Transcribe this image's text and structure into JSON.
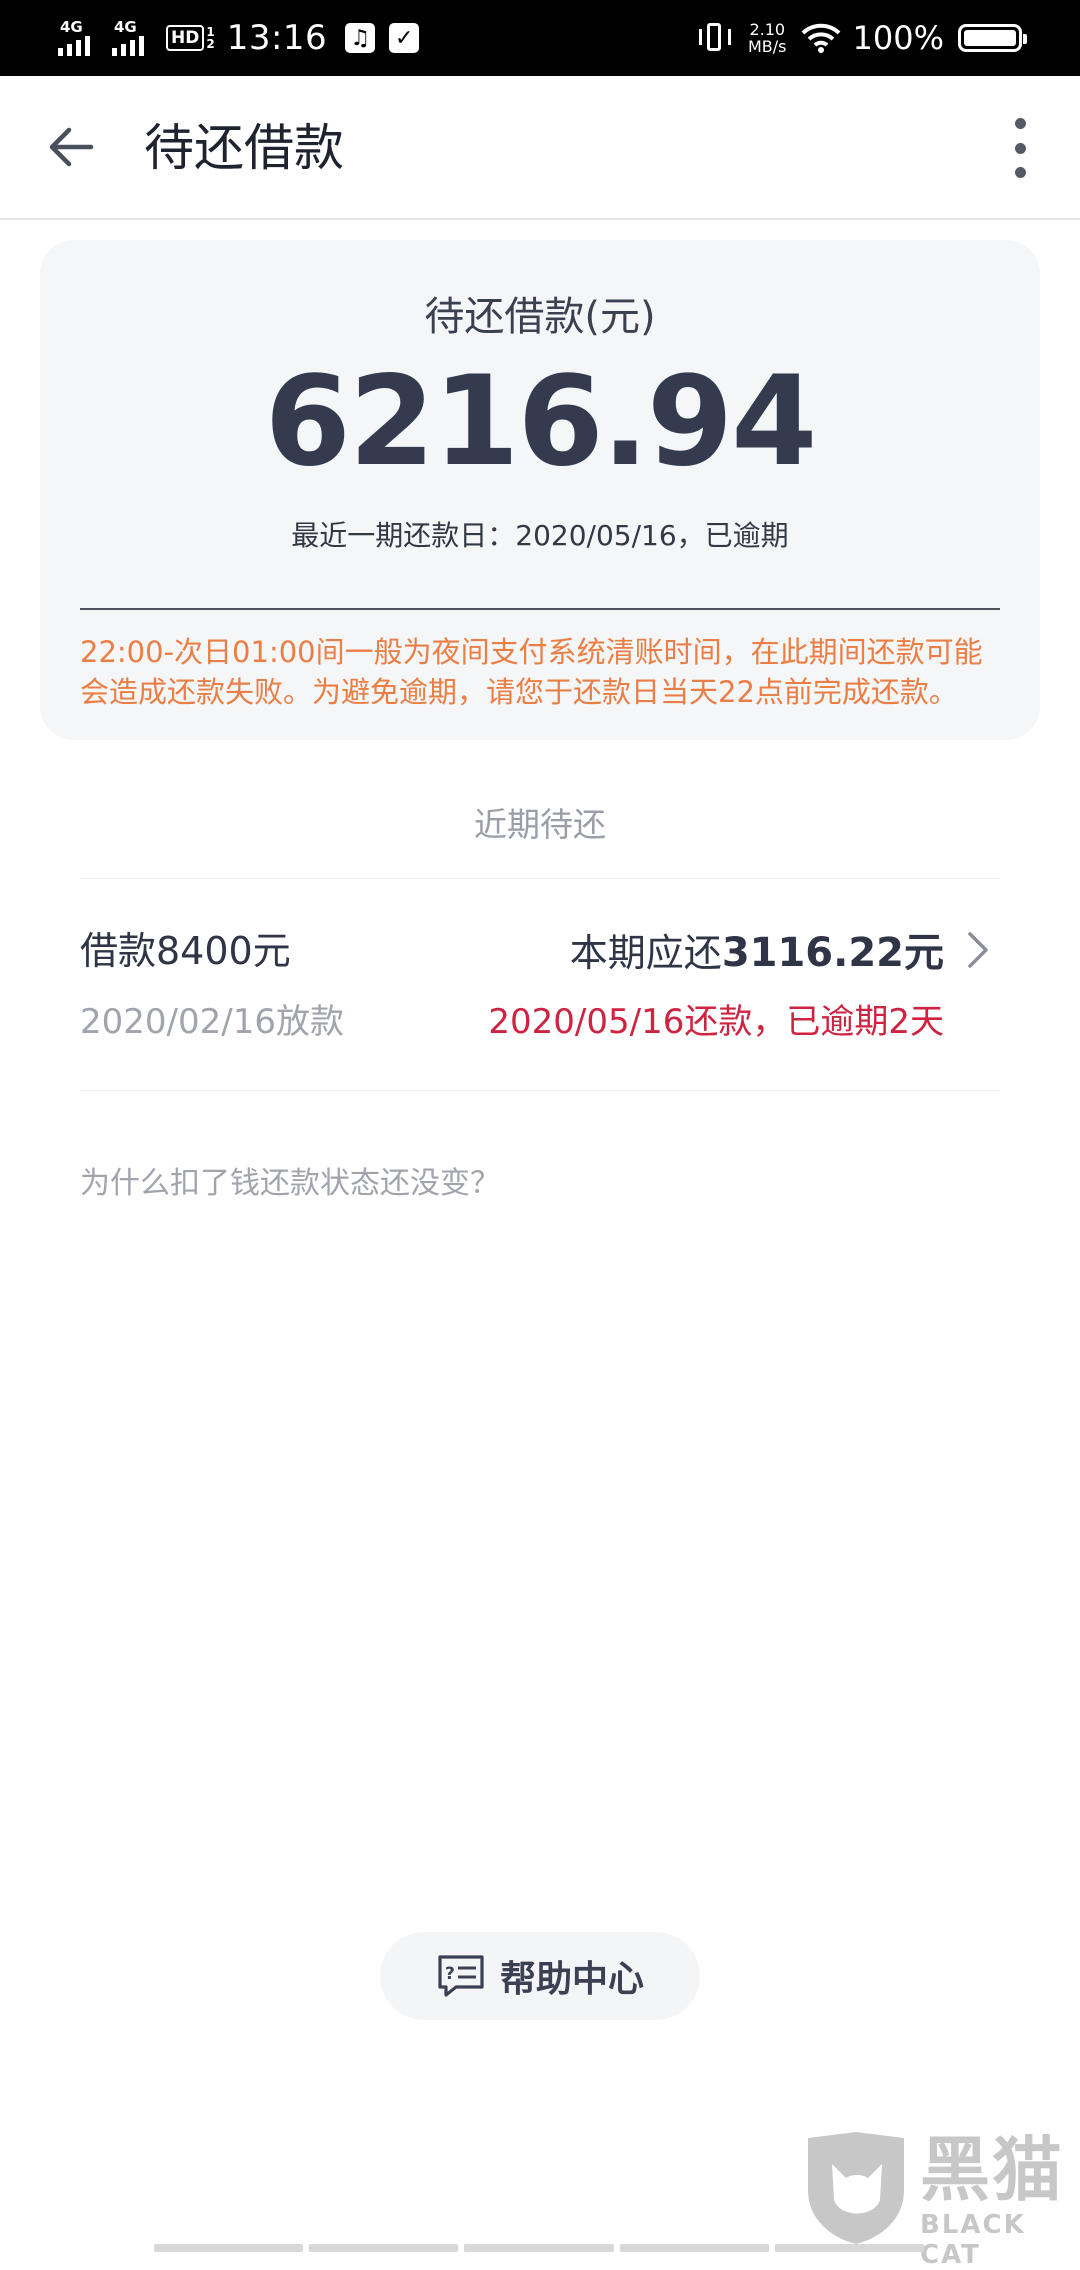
{
  "status_bar": {
    "net1": "4G",
    "net2": "4G",
    "hd_label": "HD",
    "hd_sub_top": "1",
    "hd_sub_bottom": "2",
    "time": "13:16",
    "speed_value": "2.10",
    "speed_unit": "MB/s",
    "battery_percent": "100%",
    "battery_level": 1.0
  },
  "header": {
    "title": "待还借款"
  },
  "summary": {
    "label": "待还借款(元)",
    "amount": "6216.94",
    "due_text": "最近一期还款日：2020/05/16，已逾期",
    "notice": "22:00-次日01:00间一般为夜间支付系统清账时间，在此期间还款可能会造成还款失败。为避免逾期，请您于还款日当天22点前完成还款。"
  },
  "recent": {
    "section_title": "近期待还",
    "loan": {
      "title": "借款8400元",
      "date": "2020/02/16放款",
      "due_prefix": "本期应还",
      "due_amount": "3116.22元",
      "overdue": "2020/05/16还款，已逾期2天"
    },
    "faq": "为什么扣了钱还款状态还没变？"
  },
  "help": {
    "label": "帮助中心"
  },
  "watermark": {
    "brand": "黑猫",
    "sub": "BLACK CAT"
  },
  "colors": {
    "accent_orange": "#ea7e45",
    "overdue_red": "#cf2342",
    "amount_dark": "#343b4f"
  }
}
